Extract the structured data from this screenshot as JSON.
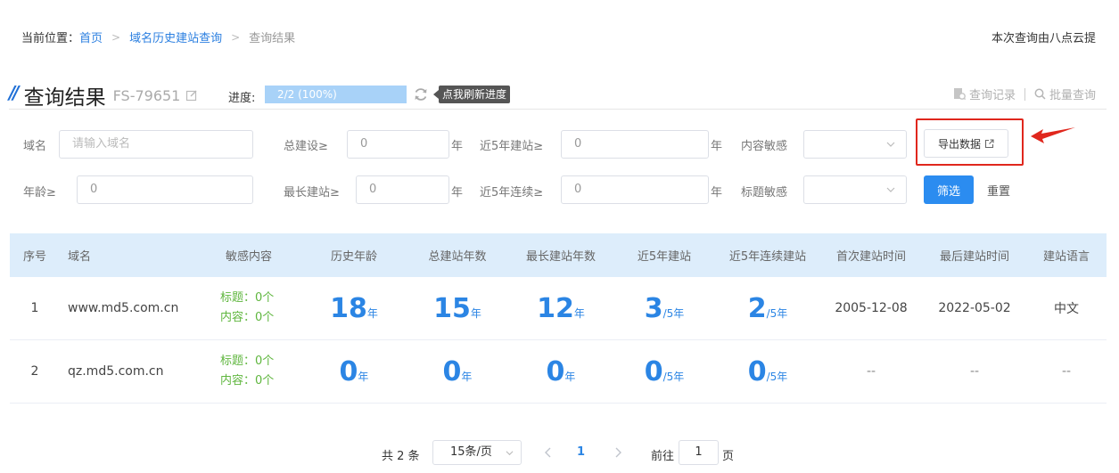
{
  "breadcrumb": {
    "prefix": "当前位置：",
    "items": [
      {
        "label": "首页"
      },
      {
        "label": "域名历史建站查询"
      },
      {
        "label": "查询结果"
      }
    ]
  },
  "provider_note": "本次查询由八点云提",
  "header": {
    "title": "查询结果",
    "task_id": "FS-79651",
    "progress_label": "进度:",
    "progress_text": "2/2 (100%)",
    "progress_value": 1.0,
    "refresh_tooltip": "点我刷新进度",
    "history_label": "查询记录",
    "batch_label": "批量查询"
  },
  "filters": {
    "domain_label": "域名",
    "domain_placeholder": "请输入域名",
    "total_build_label": "总建设≥",
    "total_build_value": "0",
    "recent5_label": "近5年建站≥",
    "recent5_value": "0",
    "content_sens_label": "内容敏感",
    "age_label": "年龄≥",
    "age_value": "0",
    "longest_label": "最长建站≥",
    "longest_value": "0",
    "recent5_cont_label": "近5年连续≥",
    "recent5_cont_value": "0",
    "title_sens_label": "标题敏感",
    "unit_year": "年",
    "export_label": "导出数据",
    "filter_label": "筛选",
    "reset_label": "重置"
  },
  "table": {
    "headers": [
      "序号",
      "域名",
      "敏感内容",
      "历史年龄",
      "总建站年数",
      "最长建站年数",
      "近5年建站",
      "近5年连续建站",
      "首次建站时间",
      "最后建站时间",
      "建站语言"
    ],
    "rows": [
      {
        "idx": "1",
        "domain": "www.md5.com.cn",
        "sens_title": "标题：0个",
        "sens_content": "内容：0个",
        "age": "18",
        "age_unit": "年",
        "total": "15",
        "total_unit": "年",
        "longest": "12",
        "longest_unit": "年",
        "recent5": "3",
        "recent5_unit": "/5年",
        "recent5c": "2",
        "recent5c_unit": "/5年",
        "first": "2005-12-08",
        "last": "2022-05-02",
        "lang": "中文"
      },
      {
        "idx": "2",
        "domain": "qz.md5.com.cn",
        "sens_title": "标题：0个",
        "sens_content": "内容：0个",
        "age": "0",
        "age_unit": "年",
        "total": "0",
        "total_unit": "年",
        "longest": "0",
        "longest_unit": "年",
        "recent5": "0",
        "recent5_unit": "/5年",
        "recent5c": "0",
        "recent5c_unit": "/5年",
        "first": "--",
        "last": "--",
        "lang": "--"
      }
    ]
  },
  "pagination": {
    "total_text": "共 2 条",
    "page_size": "15条/页",
    "current_page": "1",
    "goto_label": "前往",
    "goto_value": "1",
    "page_suffix": "页"
  },
  "colors": {
    "accent": "#2b85e4",
    "sensitive_ok": "#5fb63e",
    "highlight": "#e0271d",
    "table_header_bg": "#ddedfb"
  }
}
